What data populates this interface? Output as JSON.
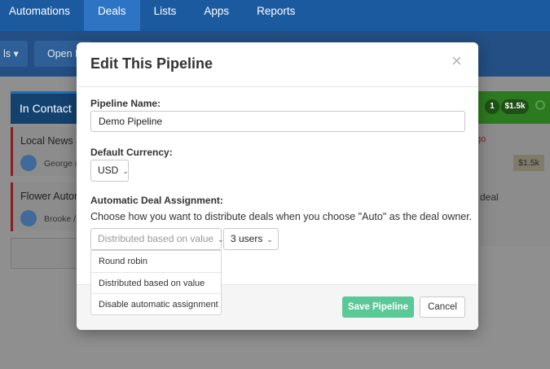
{
  "nav": {
    "items": [
      {
        "label": "Automations"
      },
      {
        "label": "Deals"
      },
      {
        "label": "Lists"
      },
      {
        "label": "Apps"
      },
      {
        "label": "Reports"
      }
    ]
  },
  "subbar": {
    "button1": "ls",
    "button2": "Open D"
  },
  "board": {
    "left_column_title": "In Contact",
    "cards": [
      {
        "title": "Local News Si",
        "owner": "George /"
      },
      {
        "title": "Flower Autom",
        "owner": "Brooke /"
      }
    ],
    "right_column": {
      "count": "1",
      "amount": "$1.5k"
    },
    "right_card_text": "go",
    "right_card_amount": "$1.5k",
    "right_card2_text": "deal"
  },
  "modal": {
    "title": "Edit This Pipeline",
    "close": "×",
    "pipeline_name_label": "Pipeline Name:",
    "pipeline_name_value": "Demo Pipeline",
    "currency_label": "Default Currency:",
    "currency_value": "USD",
    "assignment_label": "Automatic Deal Assignment:",
    "assignment_help": "Choose how you want to distribute deals when you choose \"Auto\" as the deal owner.",
    "assignment_value": "Distributed based on value",
    "users_value": "3 users",
    "dropdown_options": [
      {
        "label": "Round robin"
      },
      {
        "label": "Distributed based on value"
      },
      {
        "label": "Disable automatic assignment"
      }
    ],
    "save_label": "Save Pipeline",
    "cancel_label": "Cancel"
  }
}
